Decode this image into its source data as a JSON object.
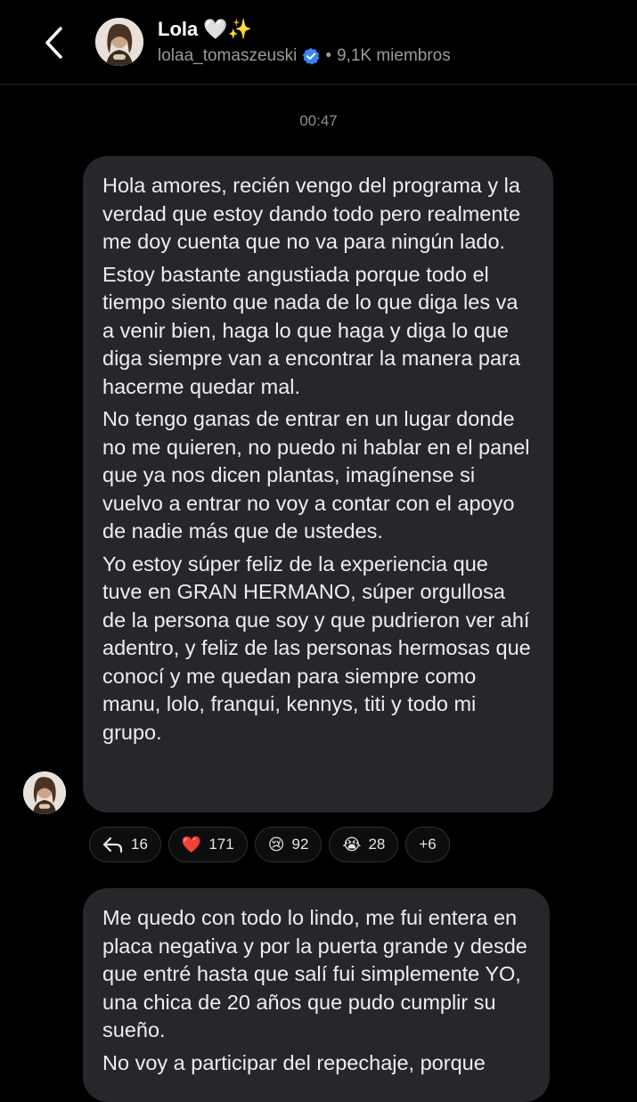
{
  "header": {
    "channel_name": "Lola",
    "name_emojis": "🤍✨",
    "username": "lolaa_tomaszeuski",
    "separator": "•",
    "members": "9,1K miembros",
    "back_icon": "chevron-left-icon",
    "verified_icon": "verified-badge-icon"
  },
  "timestamp": "00:47",
  "messages": [
    {
      "paragraphs": [
        "Hola amores, recién vengo del programa y la verdad que estoy dando todo pero realmente me doy cuenta que no va para ningún lado.",
        "Estoy bastante angustiada porque todo el tiempo siento que nada de lo que diga les va a venir bien, haga lo que haga y diga lo que diga siempre van a encontrar la manera para hacerme quedar mal.",
        "No tengo ganas de entrar en un lugar donde no me quieren, no puedo ni hablar en el panel que ya nos dicen plantas, imagínense si vuelvo a entrar no voy a contar con el apoyo de nadie más que de ustedes.",
        "Yo estoy súper feliz de la experiencia que tuve en GRAN HERMANO, súper orgullosa de la persona que soy y que pudrieron ver ahí adentro, y feliz de las personas hermosas que conocí y me quedan para siempre como manu, lolo, franqui, kennys, titi y todo mi grupo."
      ],
      "reactions": [
        {
          "icon": "reply-icon",
          "emoji": "",
          "count": "16"
        },
        {
          "icon": "heart-icon",
          "emoji": "❤️",
          "count": "171"
        },
        {
          "icon": "sad-face-icon",
          "emoji": "😢",
          "count": "92"
        },
        {
          "icon": "crying-face-icon",
          "emoji": "😭",
          "count": "28"
        },
        {
          "icon": "more-reactions",
          "emoji": "",
          "count": "+6"
        }
      ]
    },
    {
      "paragraphs": [
        "Me quedo con todo lo lindo, me fui entera en placa negativa y por la puerta grande y desde que entré hasta que salí fui simplemente YO, una chica de 20 años que pudo cumplir su sueño.",
        "No voy a participar del repechaje, porque"
      ]
    }
  ],
  "colors": {
    "background": "#000000",
    "bubble": "#26272b",
    "verified_blue": "#3b82f6",
    "heart_red": "#e0245e"
  }
}
